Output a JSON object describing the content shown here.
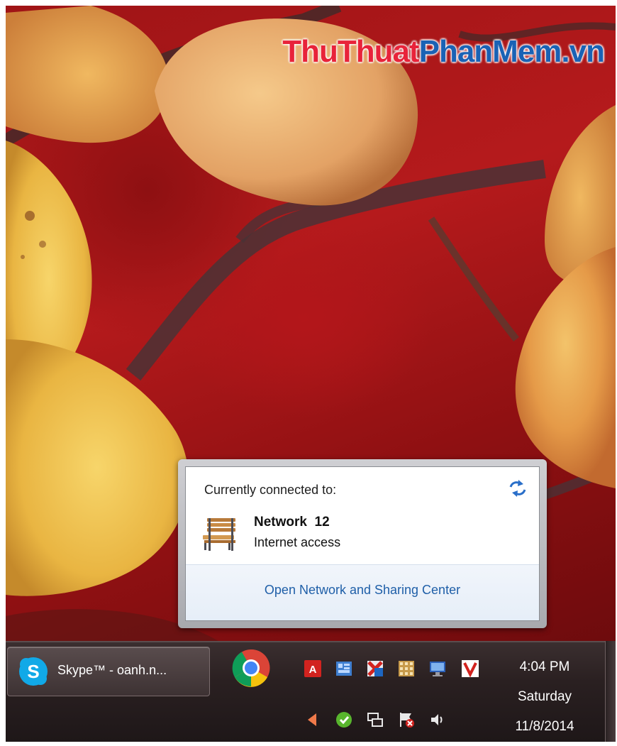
{
  "watermark": {
    "part1": "ThuThuat",
    "part2": "PhanMem",
    "part3": ".vn"
  },
  "popup": {
    "title": "Currently connected to:",
    "network_name": "Network  12",
    "network_status": "Internet access",
    "footer_link": "Open Network and Sharing Center",
    "icons": {
      "refresh": "refresh-arrows-icon",
      "network": "bench-network-icon"
    }
  },
  "taskbar": {
    "skype_label": "Skype™ - oanh.n...",
    "skype_icon": "skype-icon",
    "chrome_icon": "chrome-icon",
    "tray_top": [
      "adobe-icon",
      "window-tile-icon",
      "antivirus-icon",
      "calendar-grid-icon",
      "display-icon",
      "v-app-icon"
    ],
    "tray_bottom": [
      "arrow-left-icon",
      "green-shield-icon",
      "network-icon",
      "action-center-flag-icon",
      "volume-icon"
    ],
    "clock": {
      "time": "4:04 PM",
      "day": "Saturday",
      "date": "11/8/2014"
    }
  },
  "colors": {
    "link": "#1f5fa8",
    "taskbar": "#2a2021",
    "wallpaper": "#a3161a"
  }
}
